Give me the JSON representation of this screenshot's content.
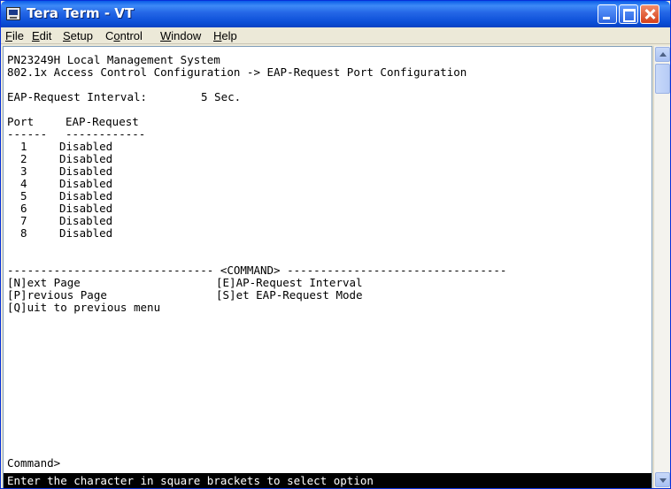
{
  "window": {
    "title": "Tera Term - VT",
    "icons": {
      "app": "terminal-icon",
      "minimize": "minimize-icon",
      "maximize": "maximize-icon",
      "close": "close-icon"
    }
  },
  "menu": [
    {
      "acc": "F",
      "rest": "ile"
    },
    {
      "acc": "E",
      "rest": "dit"
    },
    {
      "acc": "S",
      "rest": "etup"
    },
    {
      "pre": "C",
      "acc": "o",
      "rest": "ntrol"
    },
    {
      "acc": "W",
      "rest": "indow"
    },
    {
      "acc": "H",
      "rest": "elp"
    }
  ],
  "terminal": {
    "header_line1": "PN23249H Local Management System",
    "header_line2": "802.1x Access Control Configuration -> EAP-Request Port Configuration",
    "interval_label": "EAP-Request Interval:",
    "interval_value": "5 Sec.",
    "col_port": "Port",
    "col_eap": "EAP-Request",
    "col_port_underline": "------",
    "col_eap_underline": "------------",
    "ports": [
      {
        "port": "1",
        "value": "Disabled"
      },
      {
        "port": "2",
        "value": "Disabled"
      },
      {
        "port": "3",
        "value": "Disabled"
      },
      {
        "port": "4",
        "value": "Disabled"
      },
      {
        "port": "5",
        "value": "Disabled"
      },
      {
        "port": "6",
        "value": "Disabled"
      },
      {
        "port": "7",
        "value": "Disabled"
      },
      {
        "port": "8",
        "value": "Disabled"
      }
    ],
    "command_divider": "------------------------------- <COMMAND> ---------------------------------",
    "cmd_next": "[N]ext Page",
    "cmd_prev": "[P]revious Page",
    "cmd_quit": "[Q]uit to previous menu",
    "cmd_interval": "[E]AP-Request Interval",
    "cmd_mode": "[S]et EAP-Request Mode",
    "prompt": "Command>",
    "status": "Enter the character in square brackets to select option"
  }
}
